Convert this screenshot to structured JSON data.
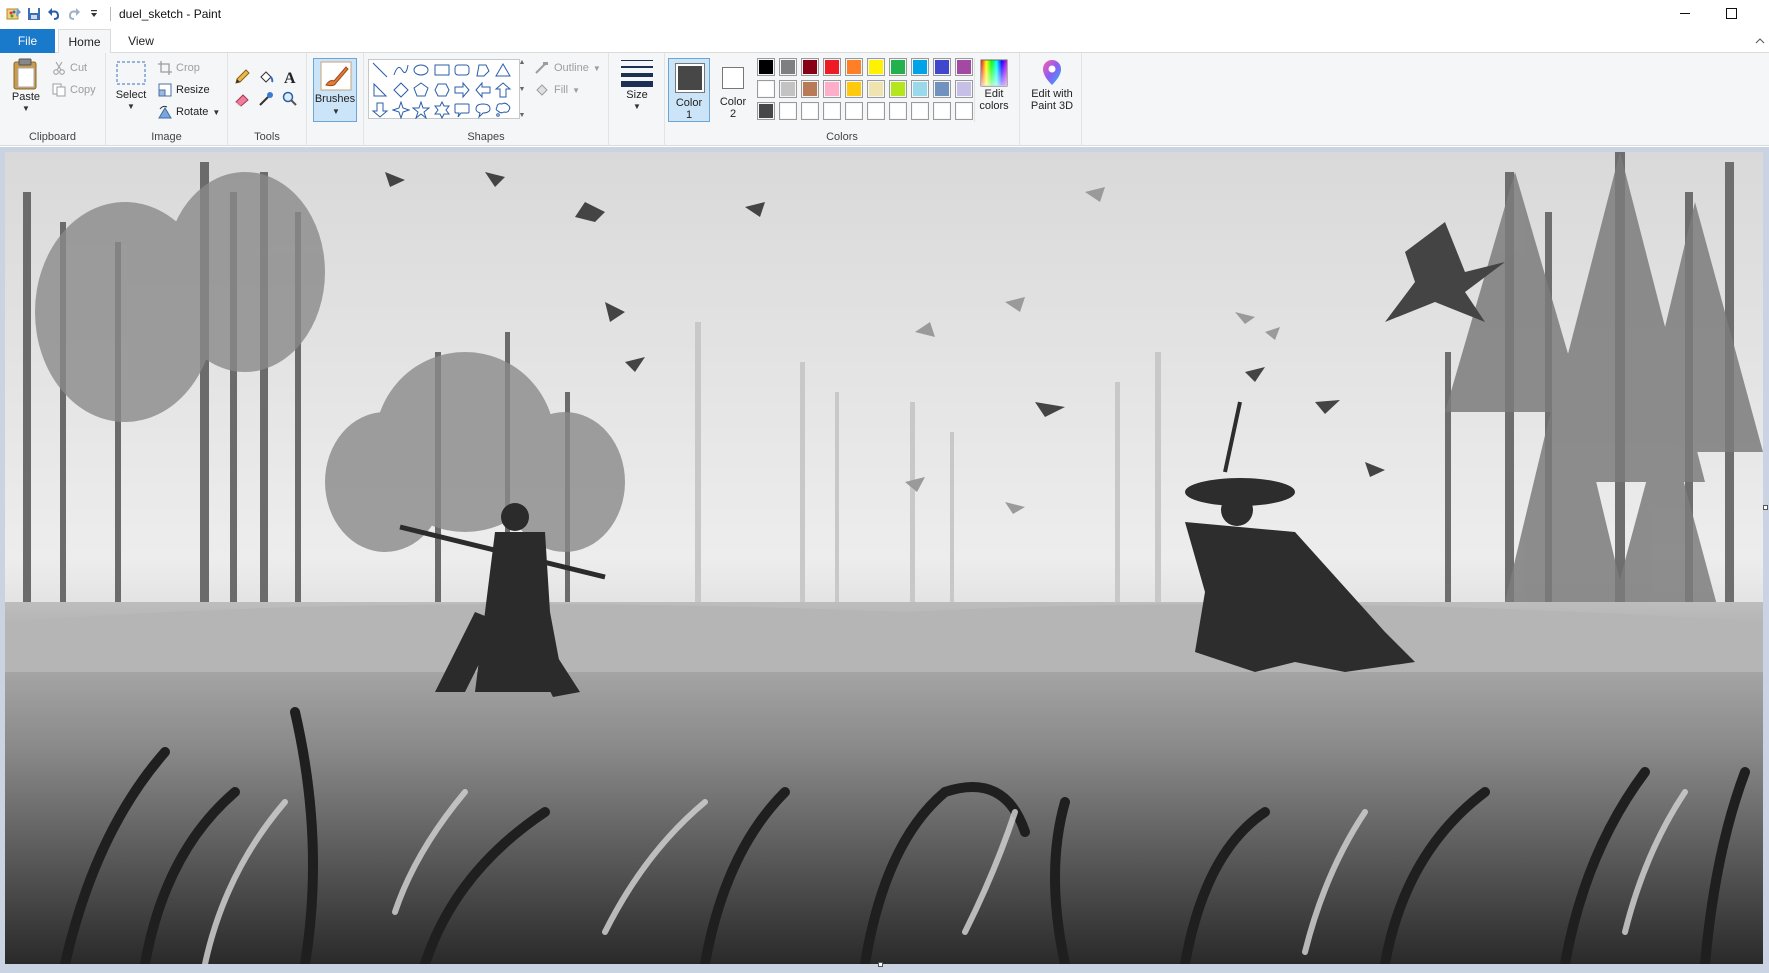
{
  "window": {
    "title": "duel_sketch - Paint"
  },
  "tabs": [
    {
      "label": "File"
    },
    {
      "label": "Home"
    },
    {
      "label": "View"
    }
  ],
  "clipboard": {
    "paste": "Paste",
    "cut": "Cut",
    "copy": "Copy",
    "group_label": "Clipboard"
  },
  "image": {
    "select": "Select",
    "crop": "Crop",
    "resize": "Resize",
    "rotate": "Rotate",
    "group_label": "Image"
  },
  "tools": {
    "group_label": "Tools",
    "items": [
      "pencil-icon",
      "fill-bucket-icon",
      "text-icon",
      "eraser-icon",
      "color-picker-icon",
      "magnifier-icon"
    ]
  },
  "brushes": {
    "label": "Brushes"
  },
  "shapes": {
    "outline": "Outline",
    "fill": "Fill",
    "group_label": "Shapes"
  },
  "size": {
    "label": "Size"
  },
  "colors": {
    "color1_label_line1": "Color",
    "color1_label_line2": "1",
    "color2_label_line1": "Color",
    "color2_label_line2": "2",
    "color1_value": "#474747",
    "color2_value": "#ffffff",
    "edit_colors_line1": "Edit",
    "edit_colors_line2": "colors",
    "group_label": "Colors",
    "palette_row1": [
      "#000000",
      "#7f7f7f",
      "#880015",
      "#ed1c24",
      "#ff7f27",
      "#fff200",
      "#22b14c",
      "#00a2e8",
      "#3f48cc",
      "#a349a4"
    ],
    "palette_row2": [
      "#ffffff",
      "#c3c3c3",
      "#b97a57",
      "#ffaec9",
      "#ffc90e",
      "#efe4b0",
      "#b5e61d",
      "#99d9ea",
      "#7092be",
      "#c8bfe7"
    ],
    "palette_row3": [
      "#474747",
      "#ffffff",
      "#ffffff",
      "#ffffff",
      "#ffffff",
      "#ffffff",
      "#ffffff",
      "#ffffff",
      "#ffffff",
      "#ffffff"
    ]
  },
  "paint3d": {
    "line1": "Edit with",
    "line2": "Paint 3D"
  }
}
